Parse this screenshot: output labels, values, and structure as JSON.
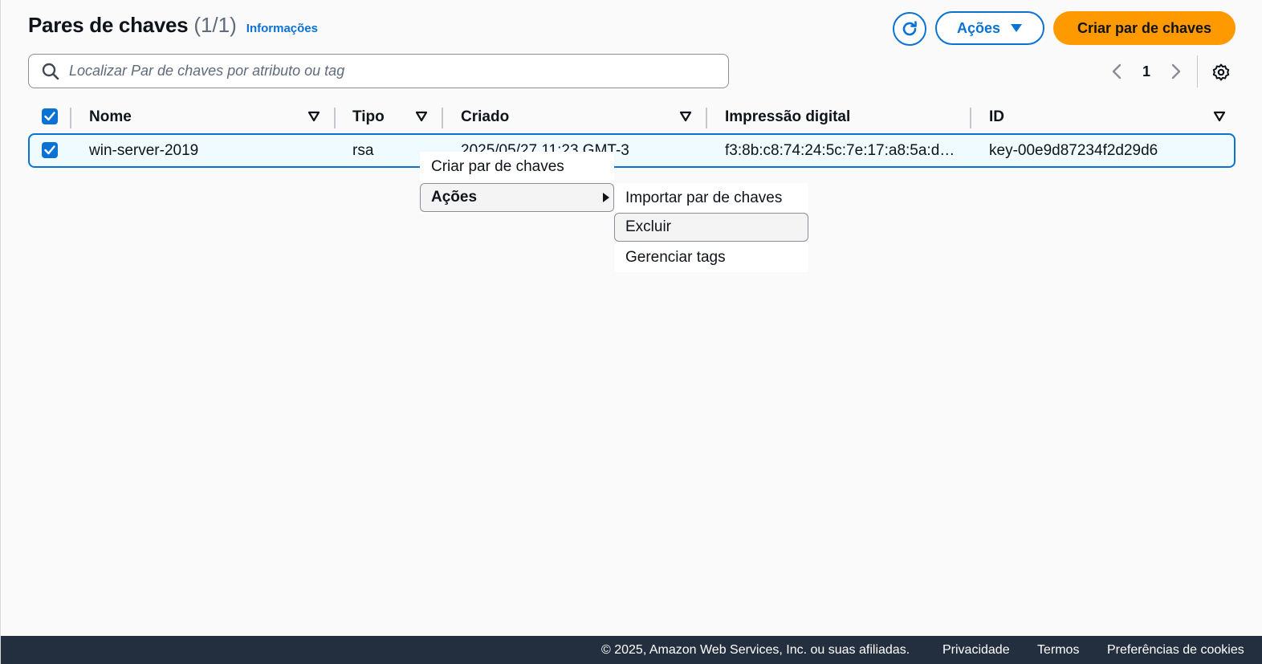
{
  "header": {
    "title": "Pares de chaves",
    "count": "(1/1)",
    "info_link": "Informações",
    "actions_label": "Ações",
    "create_label": "Criar par de chaves"
  },
  "search": {
    "placeholder": "Localizar Par de chaves por atributo ou tag",
    "value": ""
  },
  "pagination": {
    "current_page": "1"
  },
  "table": {
    "columns": [
      "Nome",
      "Tipo",
      "Criado",
      "Impressão digital",
      "ID"
    ],
    "rows": [
      {
        "selected": true,
        "name": "win-server-2019",
        "type": "rsa",
        "created": "2025/05/27 11:23 GMT-3",
        "fingerprint": "f3:8b:c8:74:24:5c:7e:17:a8:5a:d…",
        "id": "key-00e9d87234f2d29d6"
      }
    ]
  },
  "context_menu": {
    "items": [
      "Criar par de chaves",
      "Ações"
    ],
    "submenu": [
      "Importar par de chaves",
      "Excluir",
      "Gerenciar tags"
    ]
  },
  "footer": {
    "copyright": "© 2025, Amazon Web Services, Inc. ou suas afiliadas.",
    "privacy": "Privacidade",
    "terms": "Termos",
    "cookies": "Preferências de cookies"
  },
  "colors": {
    "accent": "#0972d3",
    "primary_button": "#ff9900",
    "footer_bg": "#232f3e"
  },
  "icons": [
    "refresh-icon",
    "caret-down-icon",
    "search-icon",
    "chevron-left-icon",
    "chevron-right-icon",
    "gear-icon",
    "sort-icon",
    "check-icon",
    "submenu-arrow-icon"
  ]
}
